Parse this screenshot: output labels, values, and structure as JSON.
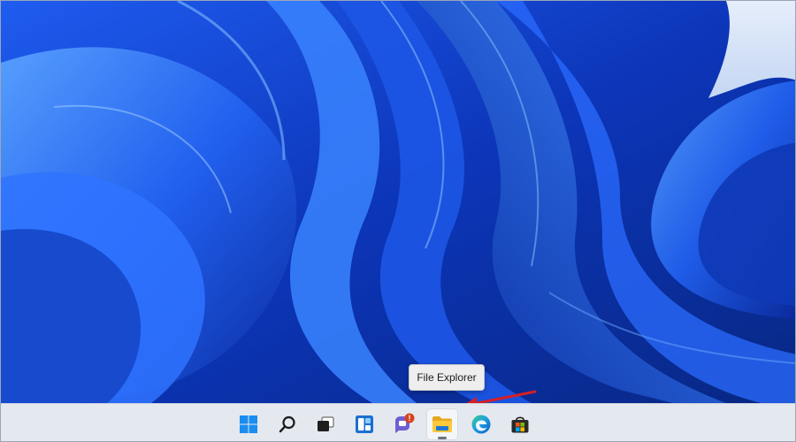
{
  "tooltip": {
    "text": "File Explorer"
  },
  "taskbar": {
    "items": [
      {
        "name": "start-button",
        "icon": "windows-logo-icon"
      },
      {
        "name": "search-button",
        "icon": "search-icon"
      },
      {
        "name": "task-view-button",
        "icon": "task-view-icon"
      },
      {
        "name": "widgets-button",
        "icon": "widgets-icon"
      },
      {
        "name": "chat-button",
        "icon": "chat-icon",
        "badge": "!"
      },
      {
        "name": "file-explorer-button",
        "icon": "folder-icon",
        "active": true
      },
      {
        "name": "edge-button",
        "icon": "edge-icon"
      },
      {
        "name": "store-button",
        "icon": "store-icon"
      }
    ]
  },
  "annotation": {
    "icon": "red-arrow-icon",
    "color": "#d61f26"
  },
  "colors": {
    "wallpaper_base": "#0b2a8c",
    "taskbar": "#e4e8ef",
    "accent": "#1f6fd6"
  }
}
